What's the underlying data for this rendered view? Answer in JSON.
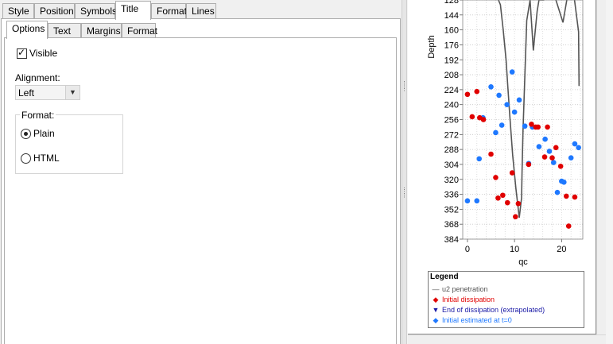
{
  "tabs_top": [
    {
      "label": "Style"
    },
    {
      "label": "Position"
    },
    {
      "label": "Symbols"
    },
    {
      "label": "Title",
      "active": true
    },
    {
      "label": "Format"
    },
    {
      "label": "Lines"
    }
  ],
  "tabs_sub": [
    {
      "label": "Options",
      "active": true
    },
    {
      "label": "Text"
    },
    {
      "label": "Margins"
    },
    {
      "label": "Format"
    }
  ],
  "options": {
    "visible_label": "Visible",
    "visible_checked": true,
    "alignment_label": "Alignment:",
    "alignment_value": "Left",
    "format_group_label": "Format:",
    "format_plain_label": "Plain",
    "format_html_label": "HTML",
    "format_selected": "Plain"
  },
  "colors": {
    "initial_dissipation": "#e00000",
    "initial_estimated": "#1e78ff",
    "u2_line": "#555555",
    "end_dissipation": "#1a1aa6"
  },
  "chart_data": {
    "type": "scatter",
    "ylabel": "Depth",
    "xlabel": "qc",
    "y_reversed": true,
    "ylim": [
      128,
      384
    ],
    "xlim": [
      -1,
      24.5
    ],
    "y_ticks": [
      128,
      144,
      160,
      176,
      192,
      208,
      224,
      240,
      256,
      272,
      288,
      304,
      320,
      336,
      352,
      368,
      384
    ],
    "x_ticks": [
      0,
      10,
      20
    ],
    "grid": true,
    "series": [
      {
        "name": "u2 penetration",
        "kind": "line",
        "points": [
          [
            5,
            122
          ],
          [
            6.5,
            127
          ],
          [
            7,
            133
          ],
          [
            7.6,
            160
          ],
          [
            8.2,
            192
          ],
          [
            8.6,
            222
          ],
          [
            9,
            252
          ],
          [
            9.6,
            294
          ],
          [
            10.3,
            330
          ],
          [
            11,
            361
          ],
          [
            11.5,
            340
          ],
          [
            11.6,
            312
          ],
          [
            11.8,
            268
          ],
          [
            12.6,
            150
          ],
          [
            13.3,
            128
          ],
          [
            14,
            182
          ],
          [
            14.8,
            140
          ],
          [
            15.2,
            128
          ],
          [
            16.2,
            128
          ],
          [
            17.3,
            122
          ],
          [
            18.8,
            128
          ],
          [
            20.3,
            152
          ],
          [
            21.3,
            122
          ],
          [
            22.6,
            122
          ],
          [
            23.6,
            162
          ],
          [
            23.7,
            220
          ]
        ]
      },
      {
        "name": "Initial dissipation",
        "kind": "markers",
        "points": [
          [
            0,
            229
          ],
          [
            1,
            253
          ],
          [
            2,
            226
          ],
          [
            2.6,
            254
          ],
          [
            3.4,
            256
          ],
          [
            5,
            293
          ],
          [
            6,
            318
          ],
          [
            6.5,
            340
          ],
          [
            7.5,
            337
          ],
          [
            8.5,
            345
          ],
          [
            9.5,
            313
          ],
          [
            10.2,
            360
          ],
          [
            10.8,
            346
          ],
          [
            13,
            304
          ],
          [
            13.6,
            261
          ],
          [
            14.5,
            264
          ],
          [
            15,
            264
          ],
          [
            16.4,
            296
          ],
          [
            17,
            264
          ],
          [
            18,
            297
          ],
          [
            18.8,
            286
          ],
          [
            19.8,
            306
          ],
          [
            21,
            338
          ],
          [
            21.5,
            370
          ],
          [
            22.8,
            339
          ],
          [
            23.7,
            389
          ]
        ]
      },
      {
        "name": "End of dissipation (extrapolated)",
        "kind": "markers",
        "points": []
      },
      {
        "name": "Initial estimated at t=0",
        "kind": "markers",
        "points": [
          [
            0,
            343
          ],
          [
            1,
            395
          ],
          [
            2,
            343
          ],
          [
            2.5,
            298
          ],
          [
            3.3,
            254
          ],
          [
            5,
            221
          ],
          [
            6,
            270
          ],
          [
            6.7,
            230
          ],
          [
            7.3,
            262
          ],
          [
            8.4,
            240
          ],
          [
            9.5,
            205
          ],
          [
            10,
            248
          ],
          [
            11,
            235
          ],
          [
            12.2,
            263
          ],
          [
            13,
            303
          ],
          [
            13.8,
            264
          ],
          [
            15.2,
            285
          ],
          [
            16.5,
            277
          ],
          [
            17.4,
            290
          ],
          [
            18.3,
            302
          ],
          [
            19.1,
            334
          ],
          [
            20,
            322
          ],
          [
            20.5,
            323
          ],
          [
            22,
            297
          ],
          [
            22.8,
            282
          ],
          [
            23.6,
            286
          ]
        ]
      }
    ]
  },
  "legend": {
    "title": "Legend",
    "items": [
      {
        "label": "u2 penetration"
      },
      {
        "label": "Initial dissipation"
      },
      {
        "label": "End of dissipation (extrapolated)"
      },
      {
        "label": "Initial estimated at t=0"
      }
    ]
  }
}
